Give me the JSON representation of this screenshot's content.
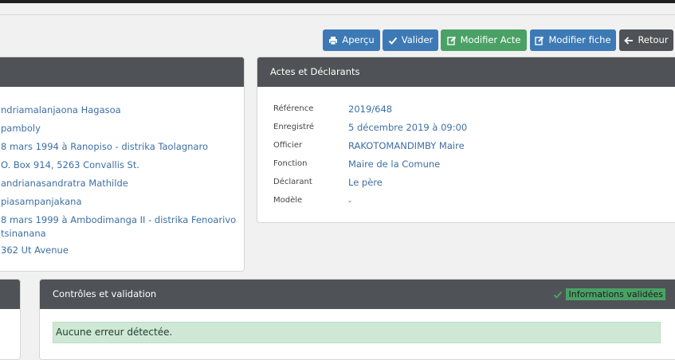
{
  "toolbar": {
    "apercu_label": "Aperçu",
    "valider_label": "Valider",
    "modifier_acte_label": "Modifier Acte",
    "modifier_fiche_label": "Modifier fiche",
    "retour_label": "Retour",
    "colors": {
      "primary": "#3d7ab5",
      "success": "#4aa165",
      "dark": "#4f5357"
    }
  },
  "left_panel": {
    "lines": [
      "ndriamalanjaona Hagasoa",
      "pamboly",
      "8 mars 1994 à Ranopiso - distrika Taolagnaro",
      "O. Box 914, 5263 Convallis St.",
      "andrianasandratra Mathilde",
      "piasampanjakana",
      "8 mars 1999 à Ambodimanga II - distrika Fenoarivo",
      "tsinanana",
      "362 Ut Avenue"
    ]
  },
  "actes": {
    "title": "Actes et Déclarants",
    "rows": [
      {
        "label": "Référence",
        "value": "2019/648"
      },
      {
        "label": "Enregistré",
        "value": "5 décembre 2019 à 09:00"
      },
      {
        "label": "Officier",
        "value": "RAKOTOMANDIMBY Maire"
      },
      {
        "label": "Fonction",
        "value": "Maire de la Comune"
      },
      {
        "label": "Déclarant",
        "value": "Le père"
      },
      {
        "label": "Modèle",
        "value": "-"
      }
    ]
  },
  "controles": {
    "title": "Contrôles et validation",
    "status_label": "Informations validées",
    "message": "Aucune erreur détectée."
  }
}
